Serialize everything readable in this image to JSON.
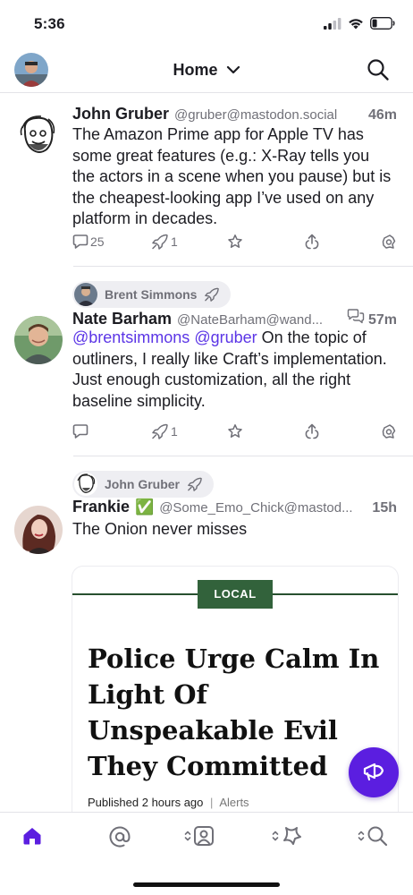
{
  "status_bar": {
    "time": "5:36"
  },
  "nav": {
    "title": "Home"
  },
  "posts": [
    {
      "display_name": "John Gruber",
      "handle": "@gruber@mastodon.social",
      "time": "46m",
      "content": "The Amazon Prime app for Apple TV has some great features (e.g.: X-Ray tells you the actors in a scene when you pause) but is the cheapest-looking app I’ve used on any platform in decades.",
      "replies": "25",
      "boosts": "1"
    },
    {
      "boosted_by": "Brent Simmons",
      "display_name": "Nate Barham",
      "handle": "@NateBarham@wand...",
      "time": "57m",
      "mention_1": "@brentsimmons",
      "mention_2": "@gruber",
      "content_rest": "On the topic of outliners, I really like Craft’s implementation. Just enough customization, all the right baseline simplicity.",
      "boosts": "1"
    },
    {
      "boosted_by": "John Gruber",
      "display_name": "Frankie",
      "verified_emoji": "✅",
      "handle": "@Some_Emo_Chick@mastod...",
      "time": "15h",
      "content": "The Onion never misses",
      "card": {
        "tag": "LOCAL",
        "headline": "Police Urge Calm In Light Of Unspeakable Evil They Committed",
        "published_label": "Published",
        "published_time": "2 hours ago",
        "separator": "|",
        "category": "Alerts"
      }
    }
  ],
  "colors": {
    "accent": "#5b1ee0",
    "mention": "#5b35e6",
    "secondary_text": "#707078",
    "card_tag": "#32623b"
  },
  "icons": [
    "reply-icon",
    "boost-icon",
    "favorite-icon",
    "share-icon",
    "more-icon",
    "home-icon",
    "mentions-icon",
    "profile-icon",
    "notifications-icon",
    "search-icon",
    "compose-icon"
  ]
}
